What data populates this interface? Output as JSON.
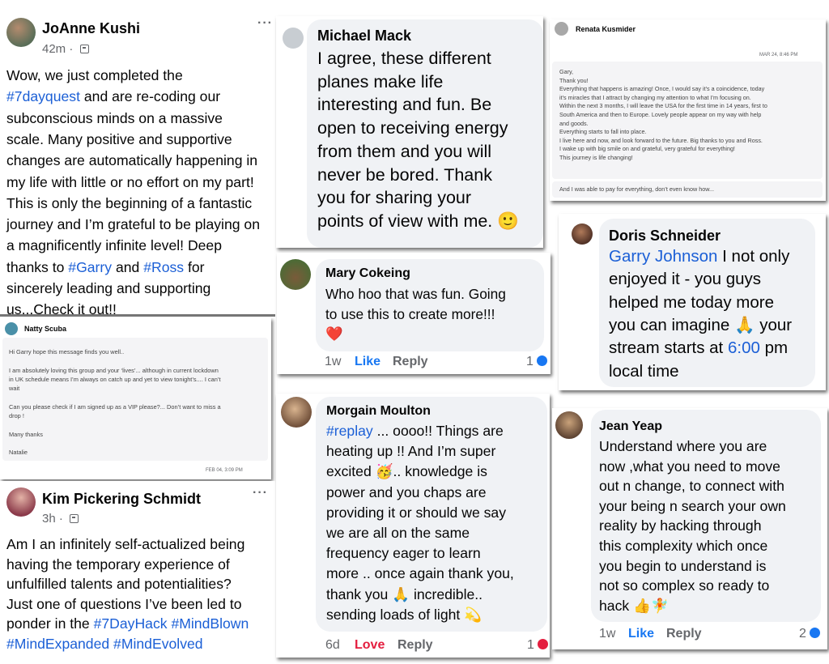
{
  "posts": {
    "joanne": {
      "name": "JoAnne Kushi",
      "time": "42m",
      "privacy_icon": "friends-icon",
      "more_icon": "more-dots-icon",
      "lines": [
        [
          {
            "t": "Wow, we just completed the"
          }
        ],
        [
          {
            "t": "#7dayquest",
            "link": true
          },
          {
            "t": " and are re-coding our"
          }
        ],
        [
          {
            "t": "subconscious minds on a massive"
          }
        ],
        [
          {
            "t": "scale. Many positive and supportive"
          }
        ],
        [
          {
            "t": "changes are automatically happening in"
          }
        ],
        [
          {
            "t": "my life with little or no effort on my part!"
          }
        ],
        [
          {
            "t": "This is only the beginning of a fantastic"
          }
        ],
        [
          {
            "t": "journey and I’m grateful to be playing on"
          }
        ],
        [
          {
            "t": "a magnificently infinite level! Deep"
          }
        ],
        [
          {
            "t": "thanks to "
          },
          {
            "t": "#Garry",
            "link": true
          },
          {
            "t": " and "
          },
          {
            "t": "#Ross",
            "link": true
          },
          {
            "t": " for"
          }
        ],
        [
          {
            "t": "sincerely leading and supporting"
          }
        ],
        [
          {
            "t": "us...Check it out!!"
          }
        ]
      ]
    },
    "kim": {
      "name": "Kim Pickering Schmidt",
      "time": "3h",
      "privacy_icon": "friends-icon",
      "more_icon": "more-dots-icon",
      "lines": [
        [
          {
            "t": "Am I an infinitely self-actualized being"
          }
        ],
        [
          {
            "t": "having the temporary experience of"
          }
        ],
        [
          {
            "t": "unfulfilled talents and potentialities?"
          }
        ],
        [
          {
            "t": "Just one of questions I’ve been led to"
          }
        ],
        [
          {
            "t": "ponder in the "
          },
          {
            "t": "#7DayHack #MindBlown",
            "link": true
          }
        ],
        [
          {
            "t": "#MindExpanded #MindEvolved",
            "link": true
          }
        ]
      ]
    }
  },
  "comments": {
    "michael": {
      "name": "Michael Mack",
      "lines": [
        [
          {
            "t": "I agree, these different"
          }
        ],
        [
          {
            "t": "planes make life"
          }
        ],
        [
          {
            "t": "interesting and fun. Be"
          }
        ],
        [
          {
            "t": "open to receiving energy"
          }
        ],
        [
          {
            "t": "from them and you will"
          }
        ],
        [
          {
            "t": "never be bored. Thank"
          }
        ],
        [
          {
            "t": "you for sharing your"
          }
        ],
        [
          {
            "t": "points of view with me. "
          },
          {
            "t": "🙂"
          }
        ]
      ]
    },
    "mary": {
      "name": "Mary Cokeing",
      "lines": [
        [
          {
            "t": "Who hoo that was fun. Going"
          }
        ],
        [
          {
            "t": "to use this to create more!!!"
          }
        ],
        [
          {
            "t": "❤️"
          }
        ]
      ],
      "time": "1w",
      "like": "Like",
      "reply": "Reply",
      "count": "1"
    },
    "morgain": {
      "name": "Morgain Moulton",
      "lines": [
        [
          {
            "t": "#replay",
            "link": true
          },
          {
            "t": " ... oooo!! Things are"
          }
        ],
        [
          {
            "t": "heating up !! And I’m super"
          }
        ],
        [
          {
            "t": "excited 🥳.. knowledge is"
          }
        ],
        [
          {
            "t": "power and you chaps are"
          }
        ],
        [
          {
            "t": "providing it or should we say"
          }
        ],
        [
          {
            "t": "we are all on the same"
          }
        ],
        [
          {
            "t": "frequency eager to learn"
          }
        ],
        [
          {
            "t": "more .. once again thank you,"
          }
        ],
        [
          {
            "t": "thank you 🙏 incredible.."
          }
        ],
        [
          {
            "t": "sending loads of light 💫"
          }
        ]
      ],
      "time": "6d",
      "like": "Love",
      "reply": "Reply",
      "count": "1"
    },
    "doris": {
      "name": "Doris Schneider",
      "lines": [
        [
          {
            "t": "Garry Johnson",
            "link": true
          },
          {
            "t": " I not only"
          }
        ],
        [
          {
            "t": "enjoyed it - you guys"
          }
        ],
        [
          {
            "t": "helped me today more"
          }
        ],
        [
          {
            "t": "you can imagine 🙏 your"
          }
        ],
        [
          {
            "t": "stream starts at "
          },
          {
            "t": "6:00",
            "link": true
          },
          {
            "t": " pm"
          }
        ],
        [
          {
            "t": "local time"
          }
        ]
      ]
    },
    "jean": {
      "name": "Jean Yeap",
      "lines": [
        [
          {
            "t": "Understand where you are"
          }
        ],
        [
          {
            "t": "now ,what you need to move"
          }
        ],
        [
          {
            "t": "out n change, to connect with"
          }
        ],
        [
          {
            "t": "your being n search your own"
          }
        ],
        [
          {
            "t": "reality by hacking through"
          }
        ],
        [
          {
            "t": "this complexity which once"
          }
        ],
        [
          {
            "t": "you begin to understand is"
          }
        ],
        [
          {
            "t": "not so complex so ready to"
          }
        ],
        [
          {
            "t": "hack 👍🧚"
          }
        ]
      ],
      "time": "1w",
      "like": "Like",
      "reply": "Reply",
      "count": "2"
    }
  },
  "messages": {
    "renata": {
      "name": "Renata Kusmider",
      "date": "MAR 24, 8:46 PM",
      "lines": [
        "Gary,",
        "Thank you!",
        "Everything that happens is amazing! Once, I would say it’s a coincidence, today",
        "it’s miracles that I attract by changing my attention to what I’m focusing on.",
        "Within the next 3 months, I will leave the USA for the first time in 14 years, first to",
        "South America and then to Europe. Lovely people appear on my way with help",
        "and goods.",
        "Everything starts to fall into place.",
        "I live here and now, and look forward to the future. Big thanks to you and Ross.",
        "I wake up with big smile on and grateful, very grateful for everything!",
        "This journey is life changing!"
      ],
      "followup": "And I was able to pay for everything, don’t even know how..."
    },
    "natty": {
      "name": "Natty Scuba",
      "date": "FEB 04, 3:09 PM",
      "lines": [
        "Hi Garry hope this message finds you well..",
        "",
        "I am absolutely loving this group and your ‘lives’... although in current lockdown",
        "in UK schedule means I’m always on catch up and yet to view tonight’s.... I can’t",
        "wait",
        "",
        "Can you please check if I am signed up as a VIP please?... Don’t want to miss a",
        "drop !",
        "",
        "Many thanks",
        "",
        "Natalie"
      ]
    }
  },
  "colors": {
    "link": "#1b5fd6",
    "meta": "#65676b",
    "bubble": "#f0f2f5",
    "love": "#e41e3f",
    "like": "#1877f2"
  }
}
